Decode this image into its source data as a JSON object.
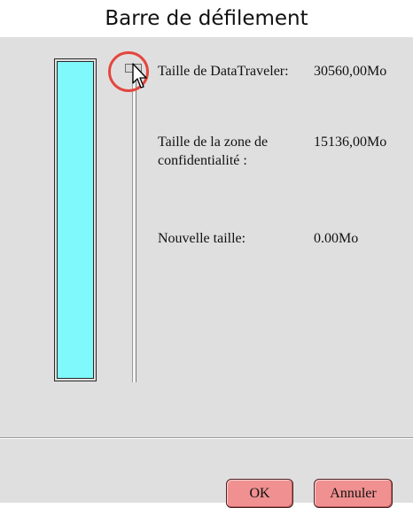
{
  "caption": "Barre de défilement",
  "dialog": {
    "fields": {
      "datatraveler_size_label": "Taille de DataTraveler:",
      "datatraveler_size_value": "30560,00Mo",
      "privacy_zone_size_label": "Taille de la zone de confidentialité :",
      "privacy_zone_size_value": "15136,00Mo",
      "new_size_label": "Nouvelle taille:",
      "new_size_value": "0.00Mo"
    },
    "buttons": {
      "ok_label": "OK",
      "cancel_label": "Annuler"
    },
    "slider": {
      "position_fraction": 0.0
    },
    "colors": {
      "bar_fill": "#7ff9fb",
      "button_fill": "#f09090",
      "highlight_ring": "#e3463e",
      "dialog_bg": "#e0dfdf"
    },
    "icons": [
      "mouse-cursor-icon",
      "highlight-circle"
    ]
  }
}
